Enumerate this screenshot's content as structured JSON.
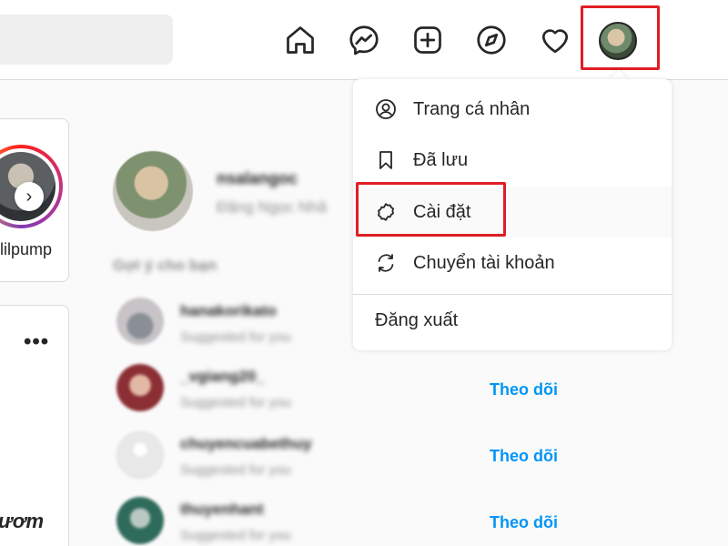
{
  "nav": {
    "icons": [
      "home-icon",
      "messenger-icon",
      "new-post-icon",
      "explore-icon",
      "activity-heart-icon",
      "profile-avatar"
    ]
  },
  "stories": {
    "username": "lilpump"
  },
  "profile": {
    "username": "nsalangoc",
    "fullname": "Đặng Ngọc Nhã"
  },
  "suggestions": {
    "title": "Gợi ý cho bạn",
    "items": [
      {
        "username": "hanakorikato",
        "subtitle": "Suggested for you",
        "follow": ""
      },
      {
        "username": "_vgiang20_",
        "subtitle": "Suggested for you",
        "follow": "Theo dõi"
      },
      {
        "username": "chuyencuabethuy",
        "subtitle": "Suggested for you",
        "follow": "Theo dõi"
      },
      {
        "username": "thuyenhant",
        "subtitle": "Suggested for you",
        "follow": "Theo dõi"
      }
    ]
  },
  "menu": {
    "profile": "Trang cá nhân",
    "saved": "Đã lưu",
    "settings": "Cài đặt",
    "switch_account": "Chuyển tài khoản",
    "logout": "Đăng xuất"
  },
  "post": {
    "caption": "ươm"
  },
  "colors": {
    "highlight": "#e11d24",
    "follow": "#0095f6"
  }
}
